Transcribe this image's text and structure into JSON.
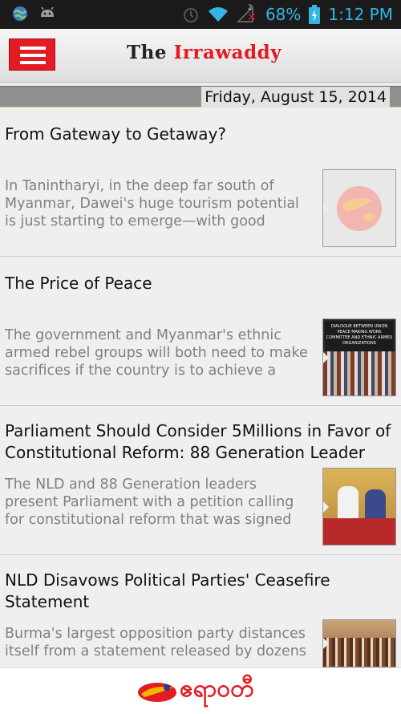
{
  "status": {
    "battery": "68%",
    "time": "1:12 PM",
    "sim_badge": "2",
    "icons": [
      "globe-icon",
      "android-icon",
      "alarm-icon",
      "wifi-icon",
      "signal-icon",
      "battery-icon"
    ]
  },
  "header": {
    "logo_part1": "The ",
    "logo_part2": "Irrawaddy",
    "accent_color": "#e31b23"
  },
  "date": "Friday, August 15, 2014",
  "articles": [
    {
      "title": "From Gateway to Getaway?",
      "summary": "In Tanintharyi, in the deep far south of Myanmar, Dawei's huge tourism potential is just starting to emerge—with good",
      "thumb": "placeholder-logo"
    },
    {
      "title": "The Price of Peace",
      "summary": "The government and Myanmar's ethnic armed rebel groups will both need to make sacrifices if the country is to achieve a",
      "thumb": "group-photo"
    },
    {
      "title": "Parliament Should Consider 5Millions in Favor of Constitutional Reform: 88 Generation Leader",
      "summary": "The NLD and 88 Generation leaders present Parliament with a petition calling for constitutional reform that was signed",
      "thumb": "meeting-photo"
    },
    {
      "title": "NLD Disavows Political Parties' Ceasefire Statement",
      "summary": "Burma's largest opposition party distances itself from a statement released by dozens",
      "thumb": "parliament-photo"
    }
  ],
  "thumb_texts": {
    "dialogue": "DIALOGUE BETWEEN UNION PEACE MAKING WORK COMMITTEE AND ETHNIC ARMED ORGANIZATIONS"
  },
  "footer": {
    "brand": "ဧရာဝတီ"
  }
}
